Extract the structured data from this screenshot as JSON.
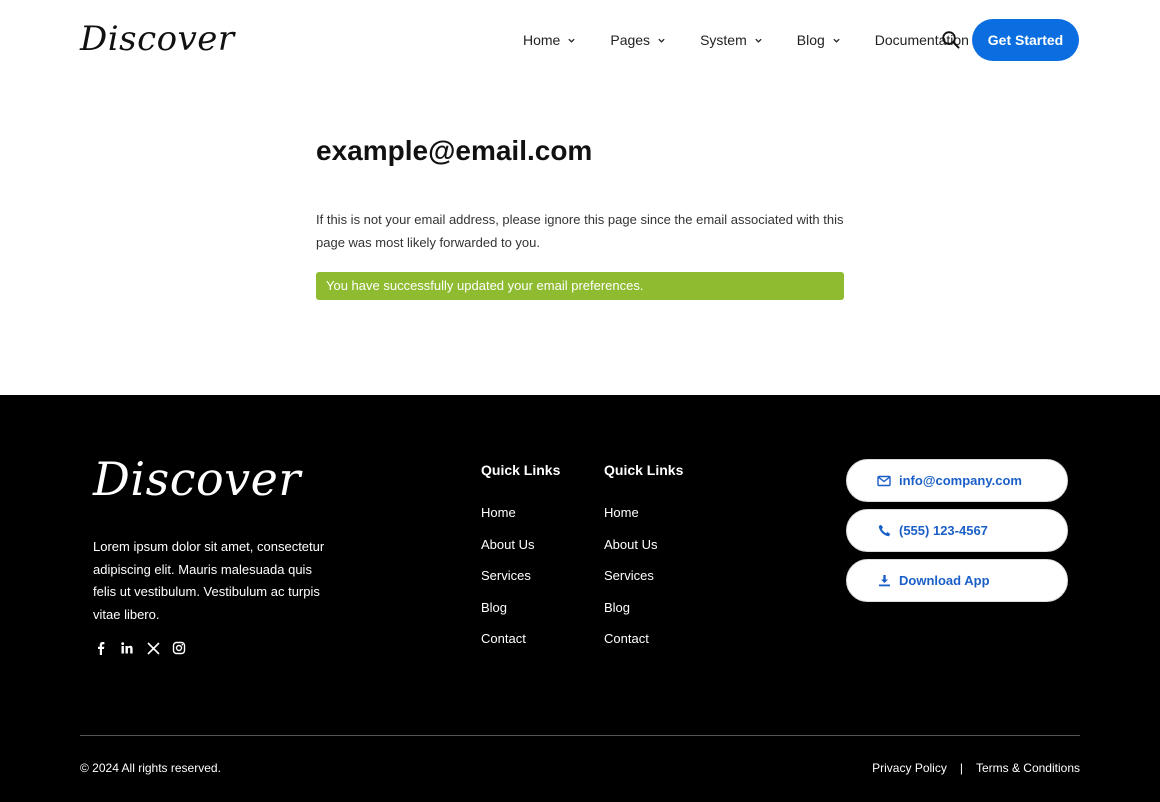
{
  "brand": {
    "logo_text": "Discover"
  },
  "nav": {
    "items": [
      {
        "label": "Home",
        "has_dropdown": true
      },
      {
        "label": "Pages",
        "has_dropdown": true
      },
      {
        "label": "System",
        "has_dropdown": true
      },
      {
        "label": "Blog",
        "has_dropdown": true
      },
      {
        "label": "Documentation",
        "has_dropdown": false
      }
    ],
    "search_icon": "search-icon",
    "cta_label": "Get Started"
  },
  "main": {
    "email": "example@email.com",
    "description": "If this is not your email address, please ignore this page since the email associated with this page was most likely forwarded to you.",
    "success_message": "You have successfully updated your email preferences."
  },
  "footer": {
    "logo_text": "Discover",
    "about": "Lorem ipsum dolor sit amet, consectetur adipiscing elit. Mauris malesuada quis felis ut vestibulum. Vestibulum ac turpis vitae libero.",
    "socials": [
      "facebook-icon",
      "linkedin-icon",
      "x-icon",
      "instagram-icon"
    ],
    "columns": [
      {
        "title": "Quick Links",
        "links": [
          "Home",
          "About Us",
          "Services",
          "Blog",
          "Contact"
        ]
      },
      {
        "title": "Quick Links",
        "links": [
          "Home",
          "About Us",
          "Services",
          "Blog",
          "Contact"
        ]
      }
    ],
    "contact": {
      "email": "info@company.com",
      "phone": "(555) 123-4567",
      "download": "Download App"
    },
    "copyright": "© 2024 All rights reserved.",
    "legal": {
      "privacy": "Privacy Policy",
      "separator": "|",
      "terms": "Terms & Conditions"
    }
  },
  "colors": {
    "accent": "#0a6ee0",
    "success": "#8fbb31",
    "footer_bg": "#000000",
    "pill_text": "#1a5fc8"
  }
}
